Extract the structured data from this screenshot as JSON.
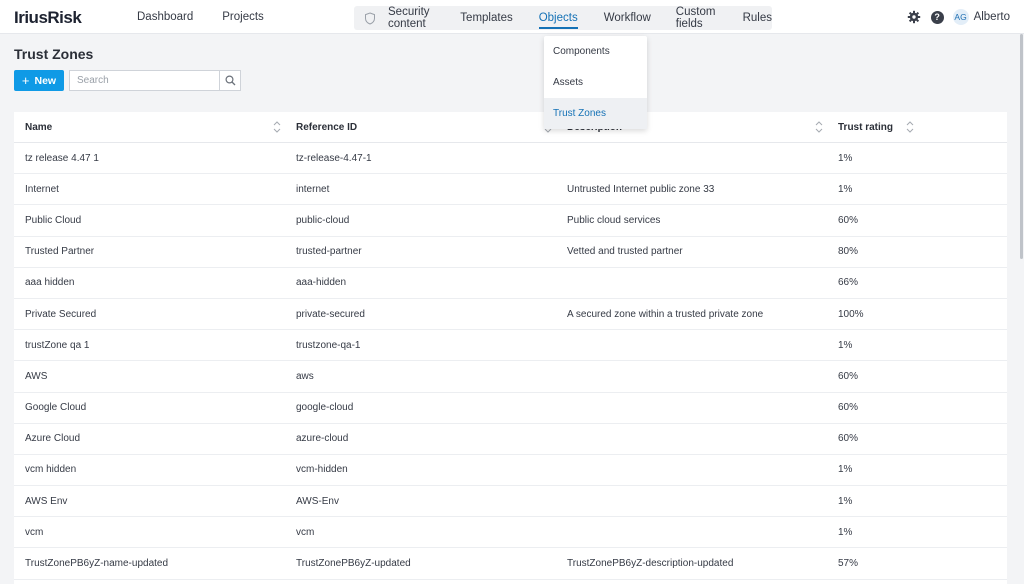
{
  "header": {
    "logo": "IriusRisk",
    "nav_left": [
      "Dashboard",
      "Projects"
    ],
    "nav_center": [
      {
        "label": "Security content",
        "active": false
      },
      {
        "label": "Templates",
        "active": false
      },
      {
        "label": "Objects",
        "active": true
      },
      {
        "label": "Workflow",
        "active": false
      },
      {
        "label": "Custom fields",
        "active": false
      },
      {
        "label": "Rules",
        "active": false
      }
    ],
    "help_label": "?",
    "user": {
      "initials": "AG",
      "name": "Alberto"
    }
  },
  "page": {
    "title": "Trust Zones",
    "new_label": "New",
    "search_placeholder": "Search"
  },
  "dropdown": {
    "items": [
      {
        "label": "Components",
        "active": false
      },
      {
        "label": "Assets",
        "active": false
      },
      {
        "label": "Trust Zones",
        "active": true
      }
    ]
  },
  "table": {
    "columns": [
      "Name",
      "Reference ID",
      "Description",
      "Trust rating"
    ],
    "rows": [
      {
        "name": "tz release 4.47 1",
        "ref": "tz-release-4.47-1",
        "desc": "",
        "rating": "1%"
      },
      {
        "name": "Internet",
        "ref": "internet",
        "desc": "Untrusted Internet public zone 33",
        "rating": "1%"
      },
      {
        "name": "Public Cloud",
        "ref": "public-cloud",
        "desc": "Public cloud services",
        "rating": "60%"
      },
      {
        "name": "Trusted Partner",
        "ref": "trusted-partner",
        "desc": "Vetted and trusted partner",
        "rating": "80%"
      },
      {
        "name": "aaa hidden",
        "ref": "aaa-hidden",
        "desc": "",
        "rating": "66%"
      },
      {
        "name": "Private Secured",
        "ref": "private-secured",
        "desc": "A secured zone within a trusted private zone",
        "rating": "100%"
      },
      {
        "name": "trustZone qa 1",
        "ref": "trustzone-qa-1",
        "desc": "",
        "rating": "1%"
      },
      {
        "name": "AWS",
        "ref": "aws",
        "desc": "",
        "rating": "60%"
      },
      {
        "name": "Google Cloud",
        "ref": "google-cloud",
        "desc": "",
        "rating": "60%"
      },
      {
        "name": "Azure Cloud",
        "ref": "azure-cloud",
        "desc": "",
        "rating": "60%"
      },
      {
        "name": "vcm hidden",
        "ref": "vcm-hidden",
        "desc": "",
        "rating": "1%"
      },
      {
        "name": "AWS Env",
        "ref": "AWS-Env",
        "desc": "",
        "rating": "1%"
      },
      {
        "name": "vcm",
        "ref": "vcm",
        "desc": "",
        "rating": "1%"
      },
      {
        "name": "TrustZonePB6yZ-name-updated",
        "ref": "TrustZonePB6yZ-updated",
        "desc": "TrustZonePB6yZ-description-updated",
        "rating": "57%"
      }
    ]
  },
  "colors": {
    "accent": "#0f9ae6",
    "active_link": "#1572b6"
  }
}
